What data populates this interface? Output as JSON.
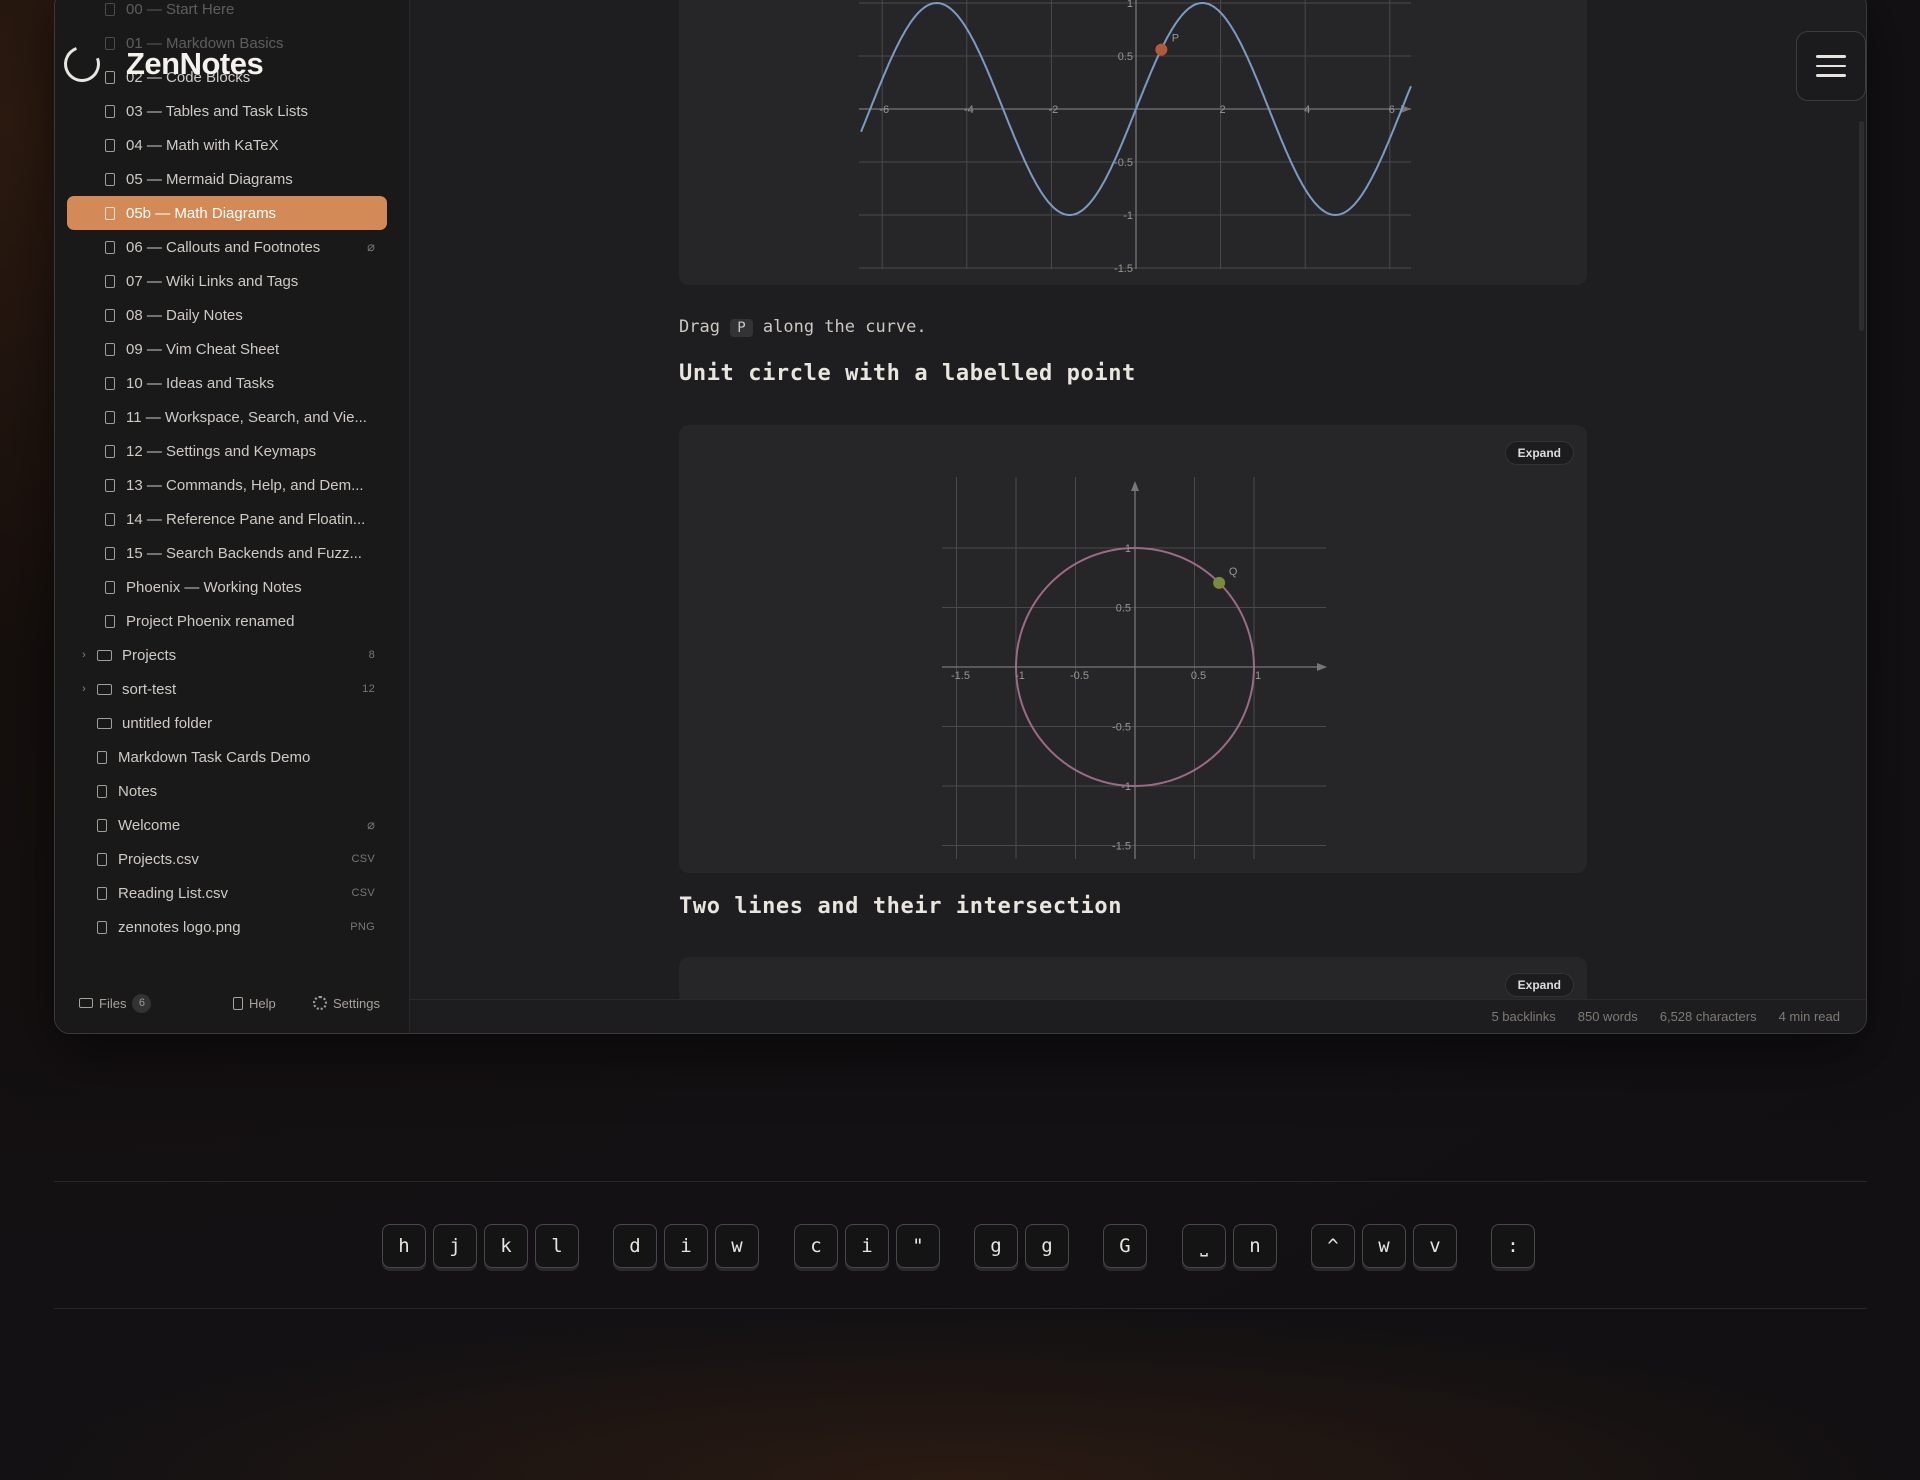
{
  "app": {
    "name": "ZenNotes"
  },
  "sidebar": {
    "items": [
      {
        "label": "00 — Start Here",
        "kind": "file",
        "faded": true
      },
      {
        "label": "01 — Markdown Basics",
        "kind": "file",
        "faded": true
      },
      {
        "label": "02 — Code Blocks",
        "kind": "file"
      },
      {
        "label": "03 — Tables and Task Lists",
        "kind": "file"
      },
      {
        "label": "04 — Math with KaTeX",
        "kind": "file"
      },
      {
        "label": "05 — Mermaid Diagrams",
        "kind": "file"
      },
      {
        "label": "05b — Math Diagrams",
        "kind": "file",
        "active": true
      },
      {
        "label": "06 — Callouts and Footnotes",
        "kind": "file",
        "attachment": true
      },
      {
        "label": "07 — Wiki Links and Tags",
        "kind": "file"
      },
      {
        "label": "08 — Daily Notes",
        "kind": "file"
      },
      {
        "label": "09 — Vim Cheat Sheet",
        "kind": "file"
      },
      {
        "label": "10 — Ideas and Tasks",
        "kind": "file"
      },
      {
        "label": "11 — Workspace, Search, and Vie...",
        "kind": "file"
      },
      {
        "label": "12 — Settings and Keymaps",
        "kind": "file"
      },
      {
        "label": "13 — Commands, Help, and Dem...",
        "kind": "file"
      },
      {
        "label": "14 — Reference Pane and Floatin...",
        "kind": "file"
      },
      {
        "label": "15 — Search Backends and Fuzz...",
        "kind": "file"
      },
      {
        "label": "Phoenix — Working Notes",
        "kind": "file"
      },
      {
        "label": "Project Phoenix renamed",
        "kind": "file"
      },
      {
        "label": "Projects",
        "kind": "folder",
        "collapsible": true,
        "count": "8"
      },
      {
        "label": "sort-test",
        "kind": "folder",
        "collapsible": true,
        "count": "12"
      },
      {
        "label": "untitled folder",
        "kind": "folder"
      },
      {
        "label": "Markdown Task Cards Demo",
        "kind": "rootfile"
      },
      {
        "label": "Notes",
        "kind": "rootfile"
      },
      {
        "label": "Welcome",
        "kind": "rootfile",
        "attachment": true
      },
      {
        "label": "Projects.csv",
        "kind": "rootfile",
        "meta": "CSV"
      },
      {
        "label": "Reading List.csv",
        "kind": "rootfile",
        "meta": "CSV"
      },
      {
        "label": "zennotes logo.png",
        "kind": "rootfile",
        "meta": "PNG"
      }
    ],
    "footer": {
      "files_label": "Files",
      "files_count": "6",
      "help_label": "Help",
      "settings_label": "Settings"
    }
  },
  "content": {
    "caption_before": "Drag",
    "caption_key": "P",
    "caption_after": "along the curve.",
    "heading_circle": "Unit circle with a labelled point",
    "heading_lines": "Two lines and their intersection",
    "expand_label": "Expand"
  },
  "chart_data": [
    {
      "type": "line",
      "series": [
        {
          "function": "sin(x)",
          "x_range": [
            -6.5,
            6.5
          ]
        }
      ],
      "point": {
        "label": "P",
        "x": 0.6,
        "y": 0.56
      },
      "x_ticks": [
        "-6",
        "-4",
        "-2",
        "2",
        "4",
        "6"
      ],
      "y_ticks": [
        "1",
        "0.5",
        "-0.5",
        "-1",
        "-1.5"
      ],
      "grid": true,
      "colors": {
        "curve": "#7c9ac3",
        "point": "#b4583a"
      }
    },
    {
      "type": "line",
      "series": [
        {
          "function": "unit circle x^2 + y^2 = 1"
        }
      ],
      "point": {
        "label": "Q",
        "x": 0.707,
        "y": 0.707
      },
      "x_ticks": [
        "-1.5",
        "-1",
        "-0.5",
        "0.5",
        "1"
      ],
      "y_ticks": [
        "1",
        "0.5",
        "-0.5",
        "-1",
        "-1.5"
      ],
      "xlim": [
        -1.6,
        1.6
      ],
      "ylim": [
        -1.6,
        1.6
      ],
      "grid": true,
      "colors": {
        "curve": "#9a6a86",
        "point": "#7c8a3c"
      }
    }
  ],
  "status": {
    "backlinks": "5 backlinks",
    "words": "850 words",
    "characters": "6,528 characters",
    "read_time": "4 min read"
  },
  "keys": [
    "h",
    "j",
    "k",
    "l",
    "d",
    "i",
    "w",
    "c",
    "i",
    "\"",
    "g",
    "g",
    "G",
    "⎵",
    "n",
    "^",
    "w",
    "v",
    ":"
  ]
}
